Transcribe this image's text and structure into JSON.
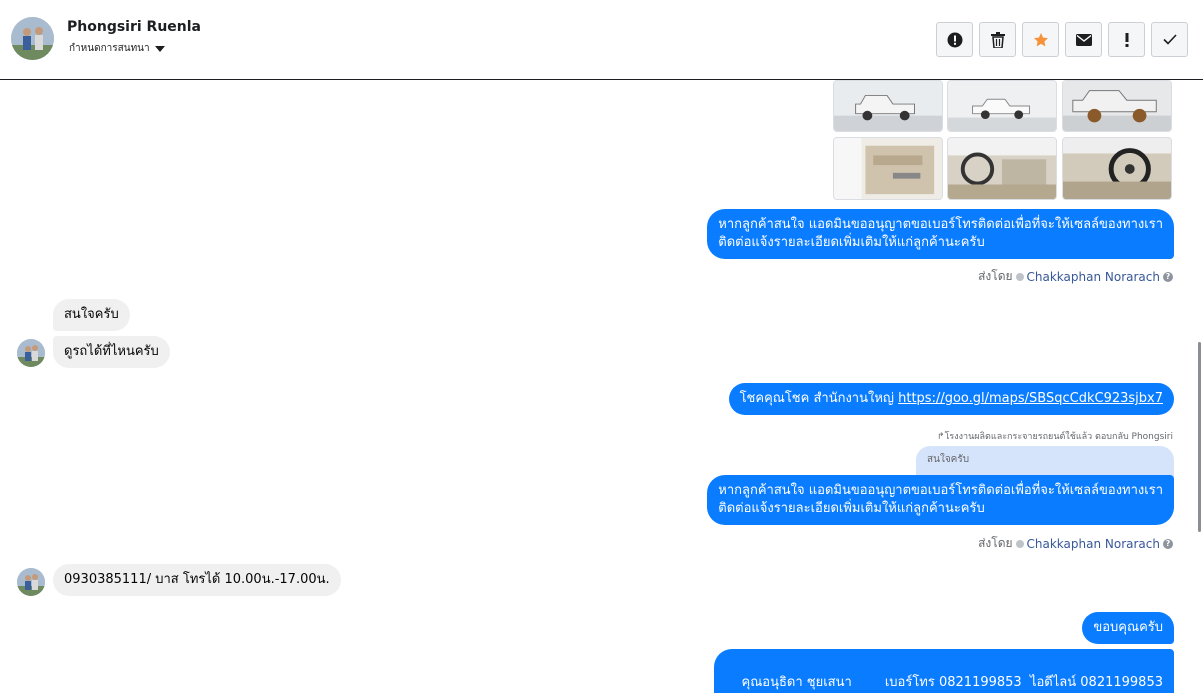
{
  "header": {
    "name": "Phongsiri Ruenla",
    "subtitle": "กำหนดการสนทนา"
  },
  "actions": [
    {
      "name": "alert-circle-icon",
      "glyph": "❗"
    },
    {
      "name": "trash-icon",
      "glyph": "🗑"
    },
    {
      "name": "star-icon",
      "glyph": "★"
    },
    {
      "name": "envelope-icon",
      "glyph": "✉"
    },
    {
      "name": "exclamation-icon",
      "glyph": "!"
    },
    {
      "name": "check-icon",
      "glyph": "✓"
    }
  ],
  "colors": {
    "accent": "#0a7cff",
    "star": "#f7923a"
  },
  "messages": {
    "m1_line1": "หากลูกค้าสนใจ แอดมินขออนุญาตขอเบอร์โทรติดต่อเพื่อที่จะให้เซลล์ของทางเรา",
    "m1_line2": "ติดต่อแจ้งรายละเอียดเพิ่มเติมให้แก่ลูกค้านะครับ",
    "sentby_label": "ส่งโดย",
    "sentby_name": "Chakkaphan Norarach",
    "in1": "สนใจครับ",
    "in2": "ดูรถได้ที่ไหนครับ",
    "out_location_text": "โชคคุณโชค สำนักงานใหญ่ ",
    "out_location_link": "https://goo.gl/maps/SBSqcCdkC923sjbx7",
    "reply_note": "โรงงานผลิตและกระจายรถยนต์ใช้แล้ว ตอบกลับ Phongsiri",
    "reply_quote": "สนใจครับ",
    "m2_line1": "หากลูกค้าสนใจ แอดมินขออนุญาตขอเบอร์โทรติดต่อเพื่อที่จะให้เซลล์ของทางเรา",
    "m2_line2": "ติดต่อแจ้งรายละเอียดเพิ่มเติมให้แก่ลูกค้านะครับ",
    "in3": "0930385111/ บาส โทรได้ 10.00น.-17.00น.",
    "out_thanks": "ขอบคุณครับ",
    "out_contact": "คุณอนุธิดา ชุยเสนา        เบอร์โทร 0821199853  ไอดีไลน์ 0821199853"
  }
}
